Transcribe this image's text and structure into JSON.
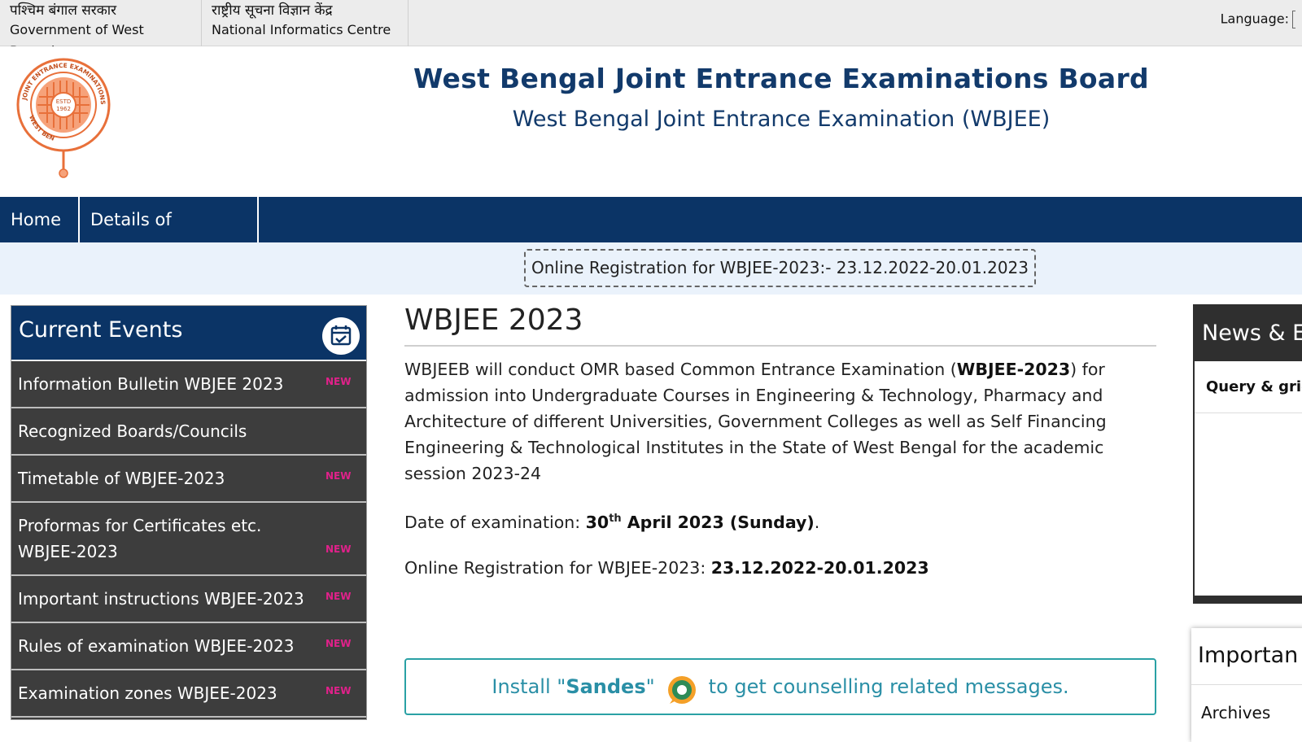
{
  "gov_bar": {
    "wb_hindi": "पश्चिम बंगाल सरकार",
    "wb_english": "Government of West Bengal",
    "nic_hindi": "राष्ट्रीय सूचना विज्ञान केंद्र",
    "nic_english": "National Informatics Centre",
    "language_label": "Language:"
  },
  "header": {
    "title": "West Bengal Joint Entrance Examinations Board",
    "subtitle": "West Bengal Joint Entrance Examination (WBJEE)",
    "logo_texts": {
      "ring_top": "JOINT ENTRANCE EXAMINATIONS BOARD",
      "ring_left": "WEST BENGAL",
      "center_l1": "ESTD",
      "center_l2": "1962"
    }
  },
  "nav": {
    "items": [
      "Home",
      "Details of Institutes"
    ]
  },
  "notice": {
    "text": "Online Registration for WBJEE-2023:- 23.12.2022-20.01.2023"
  },
  "events": {
    "title": "Current Events",
    "items": [
      {
        "label": "Information Bulletin WBJEE 2023",
        "is_new": true
      },
      {
        "label": "Recognized Boards/Councils",
        "is_new": false
      },
      {
        "label": "Timetable of WBJEE-2023",
        "is_new": true
      },
      {
        "label": "Proformas for Certificates etc. WBJEE-2023",
        "is_new": true
      },
      {
        "label": "Important instructions WBJEE-2023",
        "is_new": true
      },
      {
        "label": "Rules of examination WBJEE-2023",
        "is_new": true
      },
      {
        "label": "Examination zones WBJEE-2023",
        "is_new": true
      }
    ],
    "new_badge_text": "NEW"
  },
  "main": {
    "heading": "WBJEE 2023",
    "intro_before": "WBJEEB will conduct OMR based Common Entrance Examination (",
    "intro_bold": "WBJEE-2023",
    "intro_after": ") for admission into Undergraduate Courses in Engineering & Technology, Pharmacy and Architecture of different Universities, Government Colleges as well as Self Financing Engineering & Technological Institutes in the State of West Bengal for the academic session 2023-24",
    "exam_date_label": "Date of examination: ",
    "exam_date_day": "30",
    "exam_date_suffix": "th",
    "exam_date_rest": " April 2023 (Sunday)",
    "exam_date_end": ".",
    "registration_label": "Online Registration for WBJEE-2023: ",
    "registration_dates": "23.12.2022-20.01.2023"
  },
  "sandes": {
    "before": "Install \"",
    "app": "Sandes",
    "after_quote": "\"",
    "after": "to get counselling related messages."
  },
  "news": {
    "title": "News & E",
    "sub": "Query & grie"
  },
  "important": {
    "title": "Importan",
    "item": "Archives"
  },
  "colors": {
    "nav_bg": "#0b3466",
    "title_blue": "#123a6b",
    "events_bg": "#3d3d3d",
    "sandes_teal": "#2aa1a5",
    "logo_orange": "#e8703a"
  }
}
